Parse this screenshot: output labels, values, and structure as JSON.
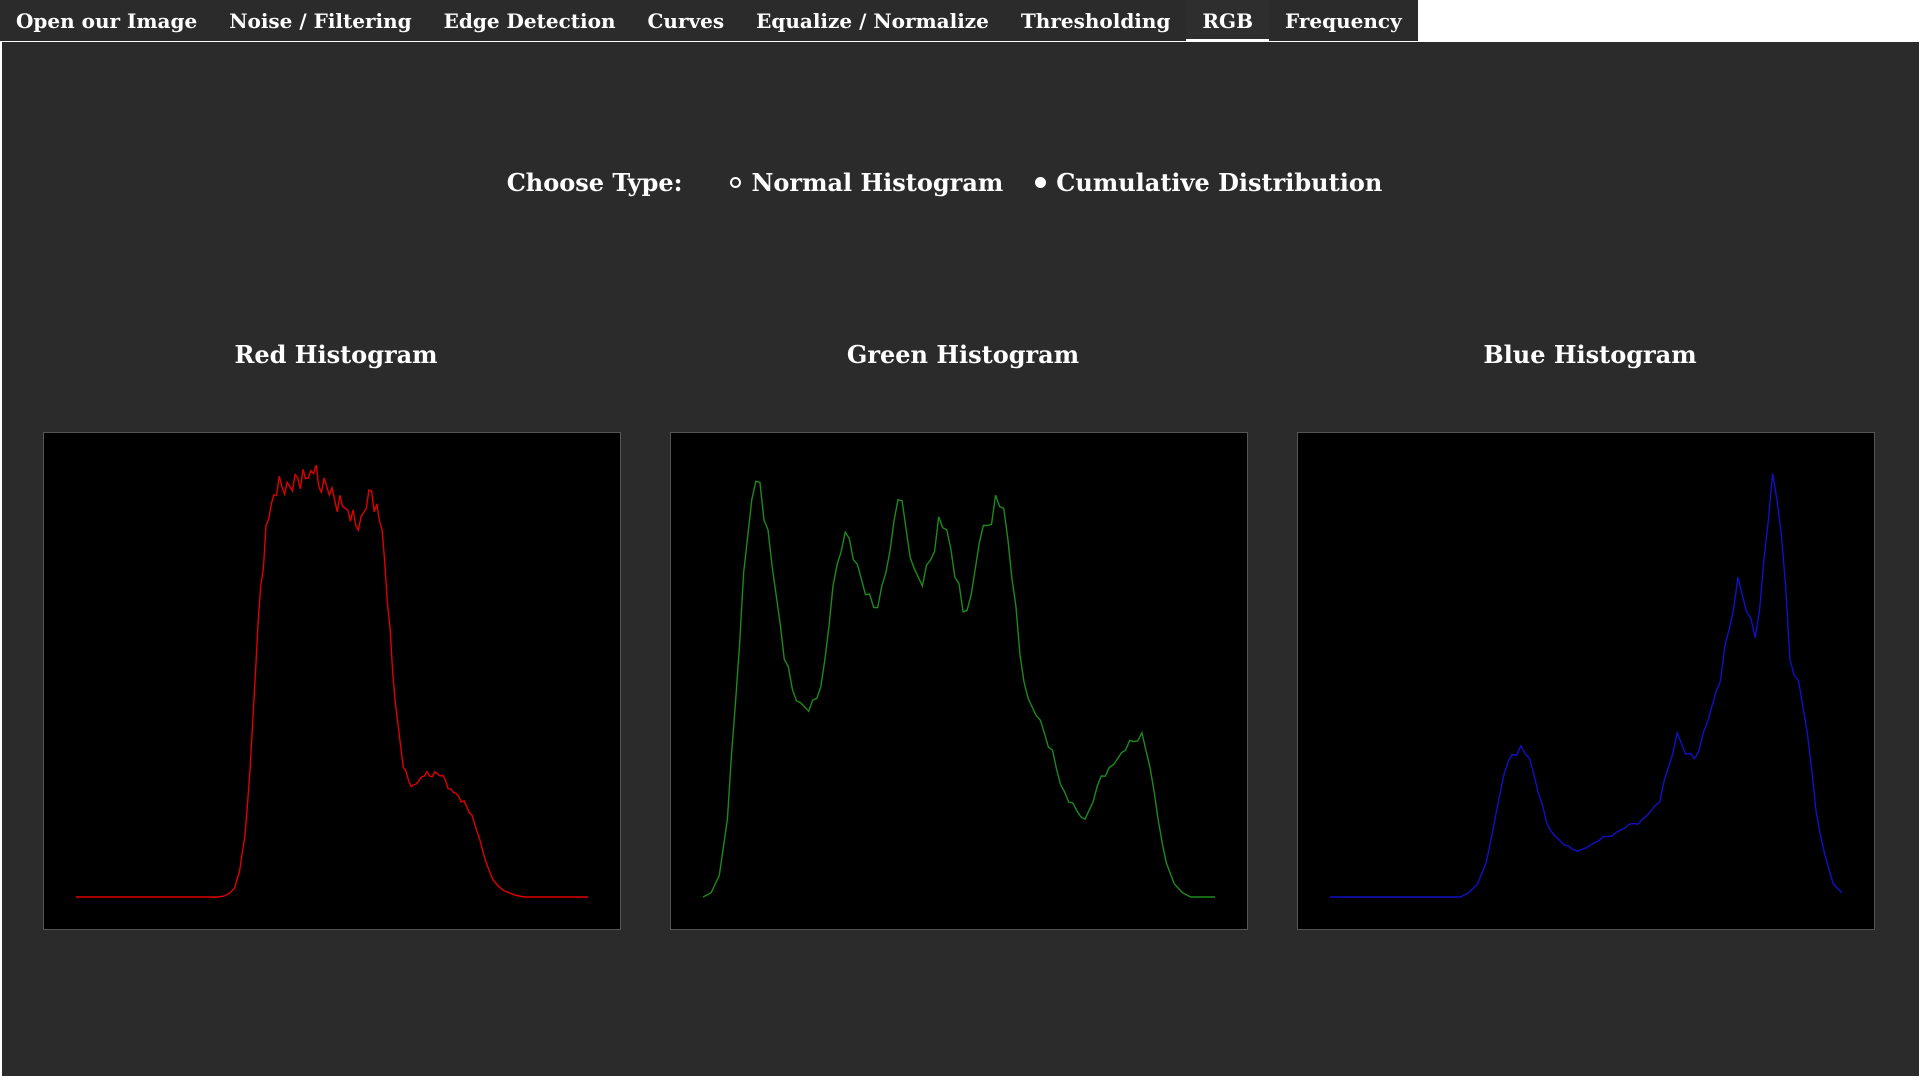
{
  "tabs": [
    {
      "label": "Open our Image",
      "active": false
    },
    {
      "label": "Noise / Filtering",
      "active": false
    },
    {
      "label": "Edge Detection",
      "active": false
    },
    {
      "label": "Curves",
      "active": false
    },
    {
      "label": "Equalize / Normalize",
      "active": false
    },
    {
      "label": "Thresholding",
      "active": false
    },
    {
      "label": "RGB",
      "active": true
    },
    {
      "label": "Frequency",
      "active": false
    }
  ],
  "type_selector": {
    "label": "Choose Type:",
    "options": [
      {
        "label": "Normal Histogram",
        "selected": false
      },
      {
        "label": "Cumulative Distribution",
        "selected": true
      }
    ]
  },
  "histograms": [
    {
      "title": "Red Histogram",
      "color": "#e00000",
      "values": [
        0,
        0,
        0,
        0,
        0,
        0,
        0,
        0,
        0,
        0,
        0,
        0,
        0,
        0,
        0,
        0,
        0,
        0,
        0,
        0,
        0,
        0,
        0,
        0,
        0,
        0,
        0,
        0,
        0.002,
        0.008,
        0.02,
        0.06,
        0.14,
        0.3,
        0.52,
        0.72,
        0.86,
        0.91,
        0.93,
        0.95,
        0.96,
        0.94,
        0.97,
        0.99,
        0.97,
        0.98,
        0.95,
        0.97,
        0.93,
        0.92,
        0.93,
        0.9,
        0.87,
        0.86,
        0.88,
        0.9,
        0.94,
        0.91,
        0.85,
        0.68,
        0.52,
        0.4,
        0.3,
        0.27,
        0.26,
        0.27,
        0.28,
        0.28,
        0.29,
        0.28,
        0.27,
        0.25,
        0.24,
        0.22,
        0.21,
        0.19,
        0.15,
        0.11,
        0.07,
        0.04,
        0.025,
        0.015,
        0.01,
        0.005,
        0.002,
        0,
        0,
        0,
        0,
        0,
        0,
        0,
        0,
        0,
        0,
        0,
        0,
        0
      ]
    },
    {
      "title": "Green Histogram",
      "color": "#1c8a1c",
      "values": [
        0,
        0.01,
        0.05,
        0.18,
        0.45,
        0.75,
        0.92,
        0.96,
        0.85,
        0.7,
        0.55,
        0.48,
        0.45,
        0.43,
        0.46,
        0.55,
        0.72,
        0.8,
        0.83,
        0.77,
        0.7,
        0.67,
        0.72,
        0.8,
        0.92,
        0.85,
        0.76,
        0.72,
        0.78,
        0.88,
        0.85,
        0.74,
        0.66,
        0.7,
        0.82,
        0.86,
        0.93,
        0.9,
        0.74,
        0.56,
        0.46,
        0.42,
        0.38,
        0.34,
        0.26,
        0.22,
        0.2,
        0.18,
        0.22,
        0.28,
        0.3,
        0.32,
        0.34,
        0.36,
        0.38,
        0.3,
        0.18,
        0.08,
        0.03,
        0.01,
        0,
        0,
        0,
        0
      ]
    },
    {
      "title": "Blue Histogram",
      "color": "#1010c8",
      "values": [
        0,
        0,
        0,
        0,
        0,
        0,
        0,
        0,
        0,
        0,
        0,
        0,
        0,
        0,
        0,
        0,
        0.01,
        0.03,
        0.08,
        0.18,
        0.28,
        0.33,
        0.35,
        0.32,
        0.24,
        0.17,
        0.14,
        0.12,
        0.11,
        0.11,
        0.12,
        0.13,
        0.14,
        0.15,
        0.16,
        0.17,
        0.18,
        0.2,
        0.22,
        0.3,
        0.38,
        0.33,
        0.32,
        0.38,
        0.44,
        0.5,
        0.62,
        0.74,
        0.66,
        0.6,
        0.78,
        0.98,
        0.84,
        0.55,
        0.5,
        0.38,
        0.2,
        0.1,
        0.03,
        0.01
      ]
    }
  ]
}
